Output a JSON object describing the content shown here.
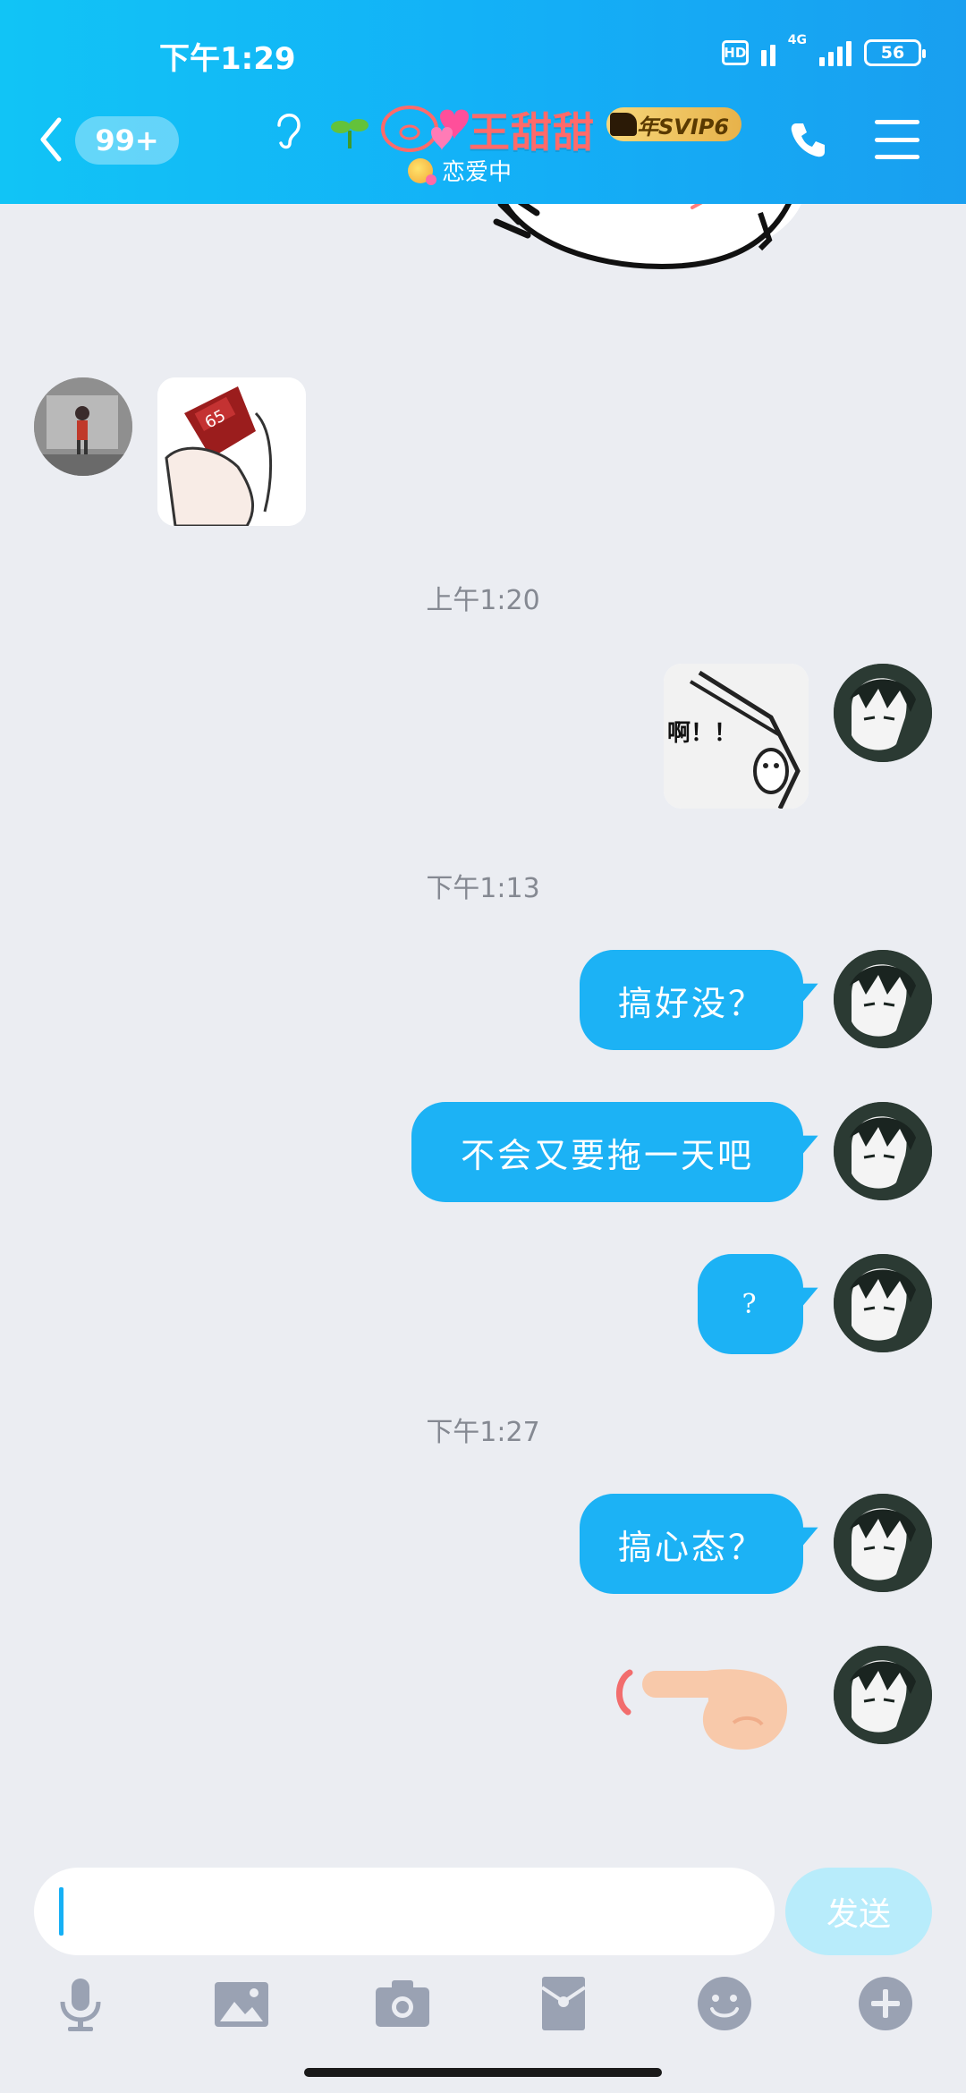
{
  "status": {
    "time": "下午1:29",
    "hd": "HD",
    "network": "4G",
    "battery": "56"
  },
  "header": {
    "unread_badge": "99+",
    "contact_name": "王甜甜",
    "vip_badge": "年SVIP6",
    "subtitle": "恋爱中"
  },
  "messages": {
    "ts1": "上午1:20",
    "ts2": "下午1:13",
    "ts3": "下午1:27",
    "sticker_text": "啊！！",
    "bubble1": "搞好没？",
    "bubble2": "不会又要拖一天吧",
    "bubble3": "?",
    "bubble4": "搞心态？"
  },
  "input": {
    "placeholder": "",
    "send_label": "发送"
  },
  "icons": [
    "back-icon",
    "ear-icon",
    "sprout-icon",
    "pig-icon",
    "phone-icon",
    "menu-icon",
    "mic-icon",
    "image-icon",
    "camera-icon",
    "red-packet-icon",
    "emoji-icon",
    "plus-icon"
  ],
  "colors": {
    "header_start": "#11c4f6",
    "header_end": "#199ff0",
    "bubble": "#1cb2f5",
    "background": "#ebedf2",
    "send_disabled": "#b8ecfb"
  }
}
